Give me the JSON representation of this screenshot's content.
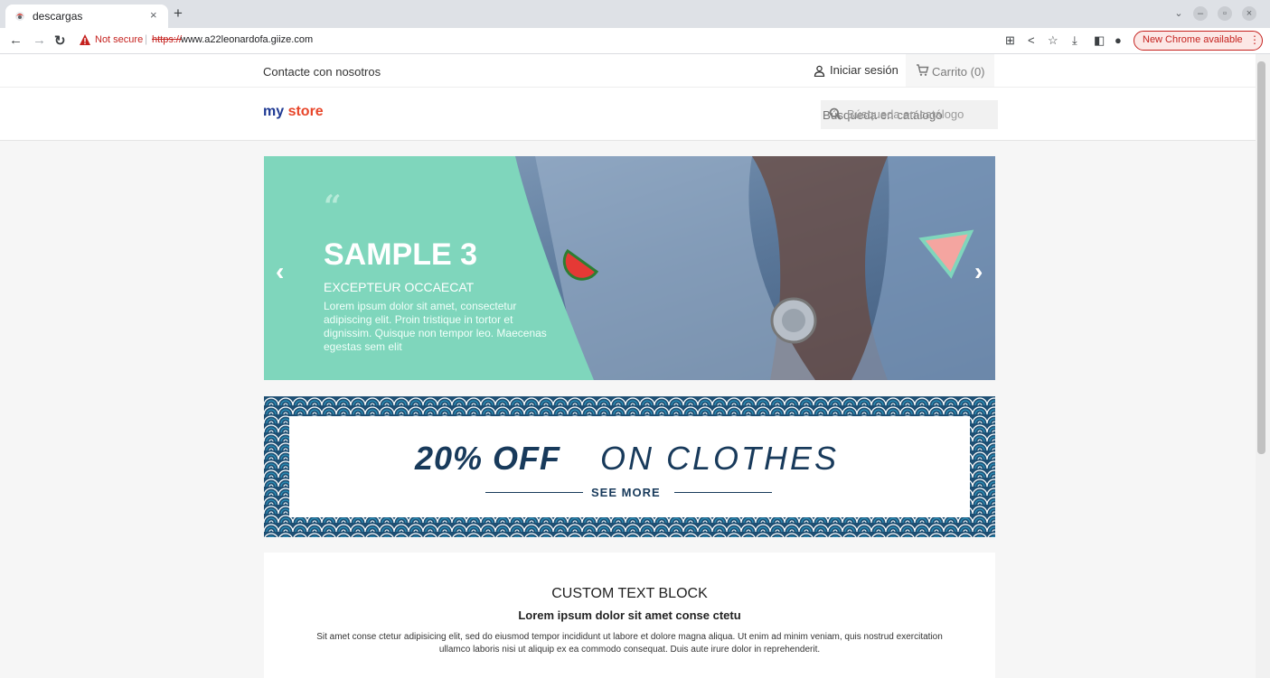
{
  "browser": {
    "tab_title": "descargas",
    "close_glyph": "×",
    "newtab_glyph": "+",
    "not_secure": "Not secure",
    "url_scheme": "https://",
    "url_host": "www.a22leonardofa.giize.com",
    "chrome_update": "New Chrome available",
    "icons": [
      "back-icon",
      "forward-icon",
      "reload-icon",
      "warning-icon",
      "translate-icon",
      "share-icon",
      "star-icon",
      "download-icon",
      "sidepanel-icon",
      "profile-icon",
      "menu-icon"
    ]
  },
  "topnav": {
    "contact": "Contacte con nosotros",
    "signin": "Iniciar sesión",
    "cart": "Carrito (0)"
  },
  "header": {
    "logo_part1": "my",
    "logo_part2": "store",
    "search_placeholder": "Búsqueda en catálogo"
  },
  "hero": {
    "quote": "“",
    "title": "SAMPLE 3",
    "subtitle": "EXCEPTEUR OCCAECAT",
    "text": "Lorem ipsum dolor sit amet, consectetur adipiscing elit. Proin tristique in tortor et dignissim. Quisque non tempor leo. Maecenas egestas sem elit",
    "prev": "‹",
    "next": "›"
  },
  "banner": {
    "strong": "20% OFF",
    "light": "ON CLOTHES",
    "cta": "SEE MORE"
  },
  "textblock": {
    "title": "CUSTOM TEXT BLOCK",
    "subtitle": "Lorem ipsum dolor sit amet conse ctetu",
    "body": "Sit amet conse ctetur adipisicing elit, sed do eiusmod tempor incididunt ut labore et dolore magna aliqua. Ut enim ad minim veniam, quis nostrud exercitation ullamco laboris nisi ut aliquip ex ea commodo consequat. Duis aute irure dolor in reprehenderit."
  },
  "colors": {
    "hero_teal": "#7fd6bc",
    "banner_navy": "#183a5b",
    "banner_wave": "#2a8fb8",
    "not_secure_red": "#c5221f"
  }
}
